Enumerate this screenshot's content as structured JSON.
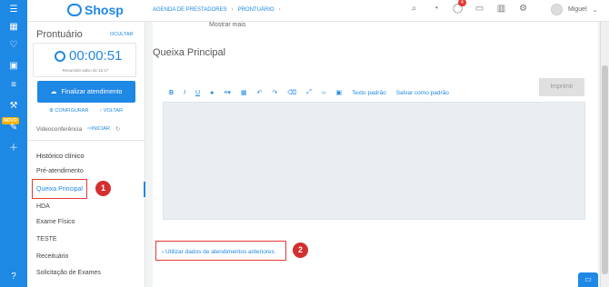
{
  "app": {
    "name": "Shosp"
  },
  "breadcrumb": [
    "AGENDA DE PRESTADORES",
    "PRONTUÁRIO"
  ],
  "header": {
    "notification_count": "4",
    "user_name": "Miguel"
  },
  "sidebar_rail": {
    "new_badge": "NOVO"
  },
  "panel": {
    "title": "Prontuário",
    "hide_label": "OCULTAR",
    "timer": "00:00:51",
    "resumed_text": "Resumido salvo às 15:17",
    "finish_label": "Finalizar atendimento",
    "config_label": "CONFIGURAR",
    "back_label": "VOLTAR",
    "video_label": "Videoconferência",
    "start_label": "INICIAR",
    "section_title": "Histórico clínico",
    "items": [
      "Pré-atendimento",
      "Queixa Principal",
      "HDA",
      "Exame Físico",
      "TESTE",
      "Receituário",
      "Solicitação de Exames"
    ]
  },
  "main": {
    "show_more": "Mostrar mais",
    "title": "Queixa Principal",
    "toolbar": {
      "bold": "B",
      "italic": "I",
      "underline": "U",
      "text_default": "Texto padrão",
      "save_default": "Salvar como padrão"
    },
    "print_label": "Imprimir",
    "use_previous": "› Utilizar dados de atendimentos anteriores"
  },
  "callouts": [
    "1",
    "2"
  ],
  "colors": {
    "accent": "#1e88e5",
    "callout": "#d32f2f"
  }
}
